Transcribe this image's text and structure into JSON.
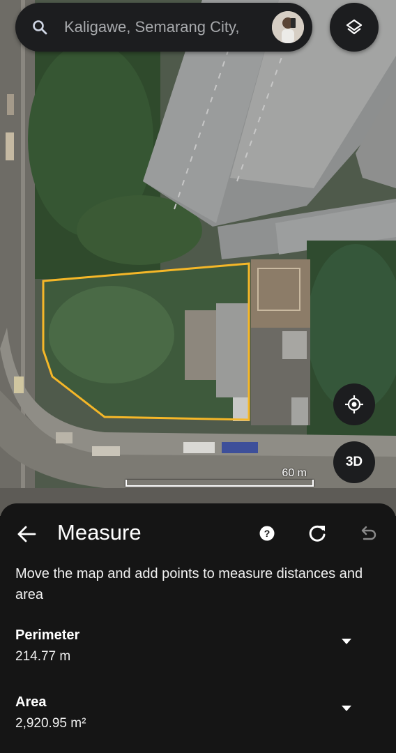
{
  "search": {
    "text": "Kaligawe, Semarang City,",
    "icon": "search-icon"
  },
  "map": {
    "scale_label": "60 m",
    "button_3d_label": "3D",
    "polygon_color": "#f5b728"
  },
  "panel": {
    "title": "Measure",
    "instructions": "Move the map and add points to measure distances and area",
    "perimeter": {
      "label": "Perimeter",
      "value": "214.77 m"
    },
    "area": {
      "label": "Area",
      "value": "2,920.95 m²"
    }
  }
}
